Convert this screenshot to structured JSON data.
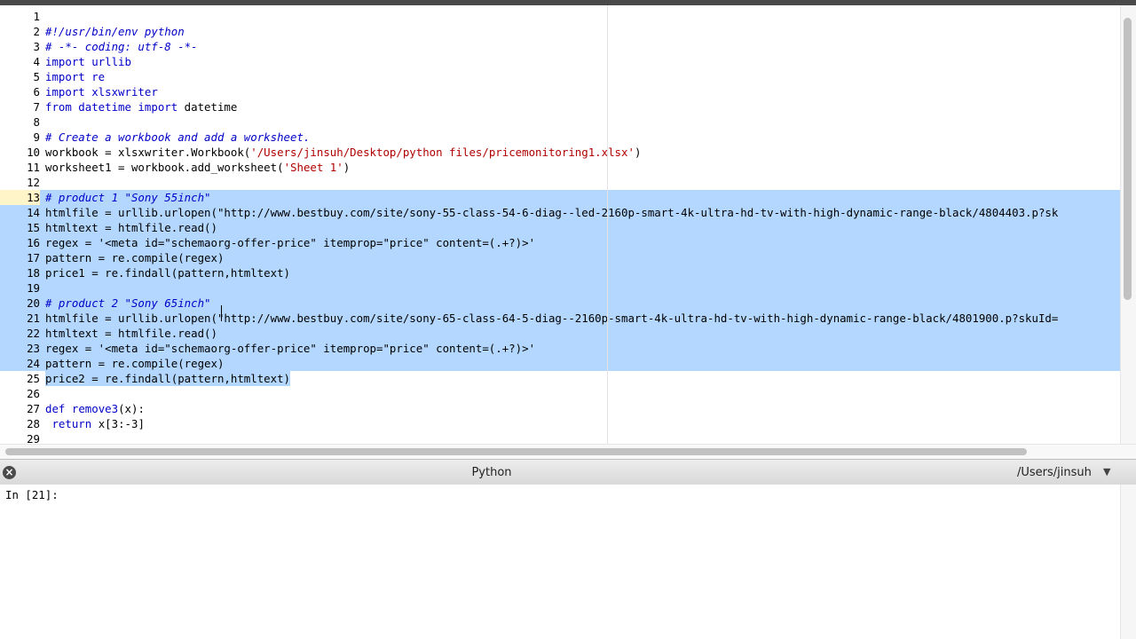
{
  "editor": {
    "lines": [
      {
        "n": "1",
        "tokens": []
      },
      {
        "n": "2",
        "tokens": [
          {
            "t": "#!/usr/bin/env python",
            "c": "com"
          }
        ]
      },
      {
        "n": "3",
        "tokens": [
          {
            "t": "# -*- coding: utf-8 -*-",
            "c": "com"
          }
        ]
      },
      {
        "n": "4",
        "tokens": [
          {
            "t": "import urllib",
            "c": "kw"
          }
        ]
      },
      {
        "n": "5",
        "tokens": [
          {
            "t": "import re",
            "c": "kw"
          }
        ]
      },
      {
        "n": "6",
        "tokens": [
          {
            "t": "import xlsxwriter",
            "c": "kw"
          }
        ]
      },
      {
        "n": "7",
        "tokens": [
          {
            "t": "from datetime import",
            "c": "kw"
          },
          {
            "t": " datetime",
            "c": ""
          }
        ]
      },
      {
        "n": "8",
        "tokens": []
      },
      {
        "n": "9",
        "tokens": [
          {
            "t": "# Create a workbook and add a worksheet.",
            "c": "com"
          }
        ]
      },
      {
        "n": "10",
        "tokens": [
          {
            "t": "workbook = xlsxwriter.Workbook(",
            "c": ""
          },
          {
            "t": "'/Users/jinsuh/Desktop/python files/pricemonitoring1.xlsx'",
            "c": "str"
          },
          {
            "t": ")",
            "c": ""
          }
        ]
      },
      {
        "n": "11",
        "tokens": [
          {
            "t": "worksheet1 = workbook.add_worksheet(",
            "c": ""
          },
          {
            "t": "'Sheet 1'",
            "c": "str"
          },
          {
            "t": ")",
            "c": ""
          }
        ]
      },
      {
        "n": "12",
        "tokens": []
      },
      {
        "n": "13",
        "tokens": [
          {
            "t": "# product 1 \"Sony 55inch\"",
            "c": "com"
          }
        ],
        "sel": true,
        "current": true
      },
      {
        "n": "14",
        "tokens": [
          {
            "t": "htmlfile = urllib.urlopen(\"http://www.bestbuy.com/site/sony-55-class-54-6-diag--led-2160p-smart-4k-ultra-hd-tv-with-high-dynamic-range-black/4804403.p?sk",
            "c": ""
          }
        ],
        "sel": true
      },
      {
        "n": "15",
        "tokens": [
          {
            "t": "htmltext = htmlfile.read()",
            "c": ""
          }
        ],
        "sel": true
      },
      {
        "n": "16",
        "tokens": [
          {
            "t": "regex = '<meta id=\"schemaorg-offer-price\" itemprop=\"price\" content=(.+?)>'",
            "c": ""
          }
        ],
        "sel": true
      },
      {
        "n": "17",
        "tokens": [
          {
            "t": "pattern = re.compile(regex)",
            "c": ""
          }
        ],
        "sel": true
      },
      {
        "n": "18",
        "tokens": [
          {
            "t": "price1 = re.findall(pattern,htmltext)",
            "c": ""
          }
        ],
        "sel": true
      },
      {
        "n": "19",
        "tokens": [],
        "sel": true
      },
      {
        "n": "20",
        "tokens": [
          {
            "t": "# product 2 \"Sony 65inch\"",
            "c": "com"
          }
        ],
        "sel": true
      },
      {
        "n": "21",
        "tokens": [
          {
            "t": "htmlfile = urllib.urlopen(\"http://www.bestbuy.com/site/sony-65-class-64-5-diag--2160p-smart-4k-ultra-hd-tv-with-high-dynamic-range-black/4801900.p?skuId=",
            "c": ""
          }
        ],
        "sel": true
      },
      {
        "n": "22",
        "tokens": [
          {
            "t": "htmltext = htmlfile.read()",
            "c": ""
          }
        ],
        "sel": true
      },
      {
        "n": "23",
        "tokens": [
          {
            "t": "regex = '<meta id=\"schemaorg-offer-price\" itemprop=\"price\" content=(.+?)>'",
            "c": ""
          }
        ],
        "sel": true
      },
      {
        "n": "24",
        "tokens": [
          {
            "t": "pattern = re.compile(regex)",
            "c": ""
          }
        ],
        "sel": true
      },
      {
        "n": "25",
        "tokens": [
          {
            "t": "price2 = re.findall(pattern,htmltext)",
            "c": ""
          }
        ],
        "sel": true,
        "part": true
      },
      {
        "n": "26",
        "tokens": []
      },
      {
        "n": "27",
        "tokens": [
          {
            "t": "def",
            "c": "kw"
          },
          {
            "t": " ",
            "c": ""
          },
          {
            "t": "remove3",
            "c": "kw"
          },
          {
            "t": "(x):",
            "c": ""
          }
        ]
      },
      {
        "n": "28",
        "tokens": [
          {
            "t": " ",
            "c": ""
          },
          {
            "t": "return",
            "c": "kw"
          },
          {
            "t": " x[3:-3]",
            "c": ""
          }
        ]
      },
      {
        "n": "29",
        "tokens": []
      }
    ]
  },
  "console": {
    "title": "Python",
    "path": "/Users/jinsuh",
    "prompt": "In [21]:",
    "close_icon": "×",
    "dropdown_icon": "▼"
  }
}
